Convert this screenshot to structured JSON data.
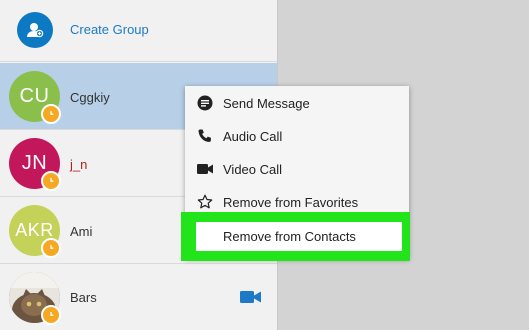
{
  "sidebar": {
    "create_group_label": "Create Group",
    "contacts": [
      {
        "name": "Cggkiy",
        "initials": "CU",
        "color": "#8bbf4b"
      },
      {
        "name": "j_n",
        "initials": "JN",
        "color": "#c2185b"
      },
      {
        "name": "Ami",
        "initials": "AKR",
        "color": "#c5d25a"
      },
      {
        "name": "Bars",
        "initials": ""
      }
    ]
  },
  "context_menu": {
    "items": [
      {
        "label": "Send Message",
        "icon": "message-icon"
      },
      {
        "label": "Audio Call",
        "icon": "phone-icon"
      },
      {
        "label": "Video Call",
        "icon": "video-camera-icon"
      },
      {
        "label": "Remove from Favorites",
        "icon": "star-outline-icon"
      },
      {
        "label": "Remove from Contacts"
      }
    ]
  },
  "colors": {
    "accent": "#1e7ac6",
    "highlight": "#21e51a",
    "selected_row": "#b8cfe8",
    "badge": "#f7a823",
    "video_icon": "#1e7ac6"
  }
}
